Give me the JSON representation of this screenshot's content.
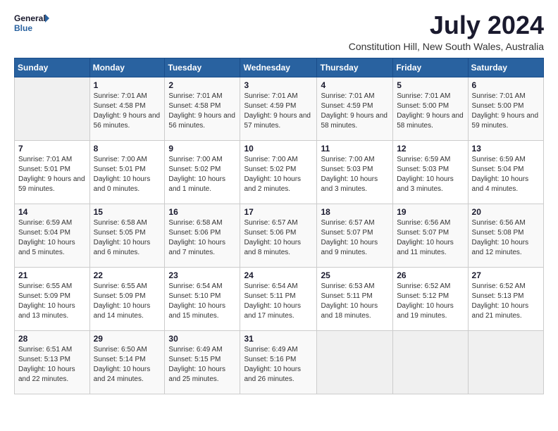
{
  "logo": {
    "line1": "General",
    "line2": "Blue"
  },
  "title": "July 2024",
  "location": "Constitution Hill, New South Wales, Australia",
  "days_of_week": [
    "Sunday",
    "Monday",
    "Tuesday",
    "Wednesday",
    "Thursday",
    "Friday",
    "Saturday"
  ],
  "weeks": [
    [
      {
        "day": "",
        "sunrise": "",
        "sunset": "",
        "daylight": ""
      },
      {
        "day": "1",
        "sunrise": "Sunrise: 7:01 AM",
        "sunset": "Sunset: 4:58 PM",
        "daylight": "Daylight: 9 hours and 56 minutes."
      },
      {
        "day": "2",
        "sunrise": "Sunrise: 7:01 AM",
        "sunset": "Sunset: 4:58 PM",
        "daylight": "Daylight: 9 hours and 56 minutes."
      },
      {
        "day": "3",
        "sunrise": "Sunrise: 7:01 AM",
        "sunset": "Sunset: 4:59 PM",
        "daylight": "Daylight: 9 hours and 57 minutes."
      },
      {
        "day": "4",
        "sunrise": "Sunrise: 7:01 AM",
        "sunset": "Sunset: 4:59 PM",
        "daylight": "Daylight: 9 hours and 58 minutes."
      },
      {
        "day": "5",
        "sunrise": "Sunrise: 7:01 AM",
        "sunset": "Sunset: 5:00 PM",
        "daylight": "Daylight: 9 hours and 58 minutes."
      },
      {
        "day": "6",
        "sunrise": "Sunrise: 7:01 AM",
        "sunset": "Sunset: 5:00 PM",
        "daylight": "Daylight: 9 hours and 59 minutes."
      }
    ],
    [
      {
        "day": "7",
        "sunrise": "Sunrise: 7:01 AM",
        "sunset": "Sunset: 5:01 PM",
        "daylight": "Daylight: 9 hours and 59 minutes."
      },
      {
        "day": "8",
        "sunrise": "Sunrise: 7:00 AM",
        "sunset": "Sunset: 5:01 PM",
        "daylight": "Daylight: 10 hours and 0 minutes."
      },
      {
        "day": "9",
        "sunrise": "Sunrise: 7:00 AM",
        "sunset": "Sunset: 5:02 PM",
        "daylight": "Daylight: 10 hours and 1 minute."
      },
      {
        "day": "10",
        "sunrise": "Sunrise: 7:00 AM",
        "sunset": "Sunset: 5:02 PM",
        "daylight": "Daylight: 10 hours and 2 minutes."
      },
      {
        "day": "11",
        "sunrise": "Sunrise: 7:00 AM",
        "sunset": "Sunset: 5:03 PM",
        "daylight": "Daylight: 10 hours and 3 minutes."
      },
      {
        "day": "12",
        "sunrise": "Sunrise: 6:59 AM",
        "sunset": "Sunset: 5:03 PM",
        "daylight": "Daylight: 10 hours and 3 minutes."
      },
      {
        "day": "13",
        "sunrise": "Sunrise: 6:59 AM",
        "sunset": "Sunset: 5:04 PM",
        "daylight": "Daylight: 10 hours and 4 minutes."
      }
    ],
    [
      {
        "day": "14",
        "sunrise": "Sunrise: 6:59 AM",
        "sunset": "Sunset: 5:04 PM",
        "daylight": "Daylight: 10 hours and 5 minutes."
      },
      {
        "day": "15",
        "sunrise": "Sunrise: 6:58 AM",
        "sunset": "Sunset: 5:05 PM",
        "daylight": "Daylight: 10 hours and 6 minutes."
      },
      {
        "day": "16",
        "sunrise": "Sunrise: 6:58 AM",
        "sunset": "Sunset: 5:06 PM",
        "daylight": "Daylight: 10 hours and 7 minutes."
      },
      {
        "day": "17",
        "sunrise": "Sunrise: 6:57 AM",
        "sunset": "Sunset: 5:06 PM",
        "daylight": "Daylight: 10 hours and 8 minutes."
      },
      {
        "day": "18",
        "sunrise": "Sunrise: 6:57 AM",
        "sunset": "Sunset: 5:07 PM",
        "daylight": "Daylight: 10 hours and 9 minutes."
      },
      {
        "day": "19",
        "sunrise": "Sunrise: 6:56 AM",
        "sunset": "Sunset: 5:07 PM",
        "daylight": "Daylight: 10 hours and 11 minutes."
      },
      {
        "day": "20",
        "sunrise": "Sunrise: 6:56 AM",
        "sunset": "Sunset: 5:08 PM",
        "daylight": "Daylight: 10 hours and 12 minutes."
      }
    ],
    [
      {
        "day": "21",
        "sunrise": "Sunrise: 6:55 AM",
        "sunset": "Sunset: 5:09 PM",
        "daylight": "Daylight: 10 hours and 13 minutes."
      },
      {
        "day": "22",
        "sunrise": "Sunrise: 6:55 AM",
        "sunset": "Sunset: 5:09 PM",
        "daylight": "Daylight: 10 hours and 14 minutes."
      },
      {
        "day": "23",
        "sunrise": "Sunrise: 6:54 AM",
        "sunset": "Sunset: 5:10 PM",
        "daylight": "Daylight: 10 hours and 15 minutes."
      },
      {
        "day": "24",
        "sunrise": "Sunrise: 6:54 AM",
        "sunset": "Sunset: 5:11 PM",
        "daylight": "Daylight: 10 hours and 17 minutes."
      },
      {
        "day": "25",
        "sunrise": "Sunrise: 6:53 AM",
        "sunset": "Sunset: 5:11 PM",
        "daylight": "Daylight: 10 hours and 18 minutes."
      },
      {
        "day": "26",
        "sunrise": "Sunrise: 6:52 AM",
        "sunset": "Sunset: 5:12 PM",
        "daylight": "Daylight: 10 hours and 19 minutes."
      },
      {
        "day": "27",
        "sunrise": "Sunrise: 6:52 AM",
        "sunset": "Sunset: 5:13 PM",
        "daylight": "Daylight: 10 hours and 21 minutes."
      }
    ],
    [
      {
        "day": "28",
        "sunrise": "Sunrise: 6:51 AM",
        "sunset": "Sunset: 5:13 PM",
        "daylight": "Daylight: 10 hours and 22 minutes."
      },
      {
        "day": "29",
        "sunrise": "Sunrise: 6:50 AM",
        "sunset": "Sunset: 5:14 PM",
        "daylight": "Daylight: 10 hours and 24 minutes."
      },
      {
        "day": "30",
        "sunrise": "Sunrise: 6:49 AM",
        "sunset": "Sunset: 5:15 PM",
        "daylight": "Daylight: 10 hours and 25 minutes."
      },
      {
        "day": "31",
        "sunrise": "Sunrise: 6:49 AM",
        "sunset": "Sunset: 5:16 PM",
        "daylight": "Daylight: 10 hours and 26 minutes."
      },
      {
        "day": "",
        "sunrise": "",
        "sunset": "",
        "daylight": ""
      },
      {
        "day": "",
        "sunrise": "",
        "sunset": "",
        "daylight": ""
      },
      {
        "day": "",
        "sunrise": "",
        "sunset": "",
        "daylight": ""
      }
    ]
  ]
}
